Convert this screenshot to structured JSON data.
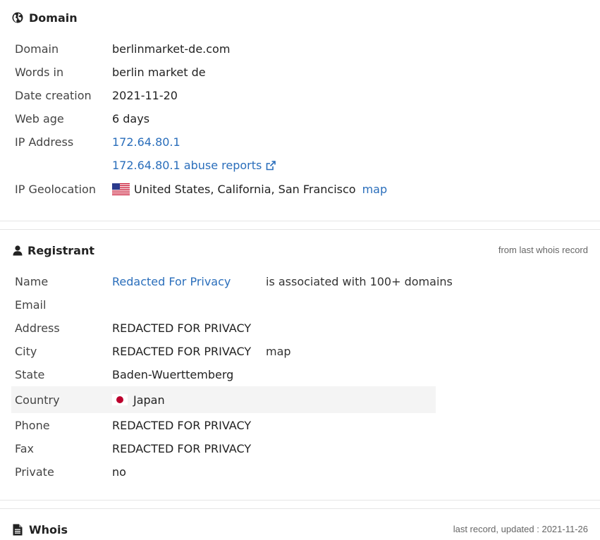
{
  "domain_section": {
    "title": "Domain",
    "rows": {
      "domain": {
        "label": "Domain",
        "value": "berlinmarket-de.com"
      },
      "words": {
        "label": "Words in",
        "value": "berlin market de"
      },
      "creation": {
        "label": "Date creation",
        "value": "2021-11-20"
      },
      "webage": {
        "label": "Web age",
        "value": "6 days"
      },
      "ip": {
        "label": "IP Address",
        "value": "172.64.80.1"
      },
      "abuse": {
        "value": "172.64.80.1 abuse reports"
      },
      "geo": {
        "label": "IP Geolocation",
        "value": "United States, California, San Francisco",
        "map": "map"
      }
    }
  },
  "registrant_section": {
    "title": "Registrant",
    "note": "from last whois record",
    "rows": {
      "name": {
        "label": "Name",
        "value": "Redacted For Privacy",
        "extra": "is associated with 100+ domains"
      },
      "email": {
        "label": "Email",
        "value": ""
      },
      "address": {
        "label": "Address",
        "value": "REDACTED FOR PRIVACY"
      },
      "city": {
        "label": "City",
        "value": "REDACTED FOR PRIVACY",
        "map": "map"
      },
      "state": {
        "label": "State",
        "value": "Baden-Wuerttemberg"
      },
      "country": {
        "label": "Country",
        "value": "Japan"
      },
      "phone": {
        "label": "Phone",
        "value": "REDACTED FOR PRIVACY"
      },
      "fax": {
        "label": "Fax",
        "value": "REDACTED FOR PRIVACY"
      },
      "private": {
        "label": "Private",
        "value": "no"
      }
    }
  },
  "whois_section": {
    "title": "Whois",
    "note": "last record, updated : 2021-11-26"
  },
  "colors": {
    "link": "#2a6ebb",
    "shaded_row": "#f4f4f4",
    "divider": "#e6e6e6"
  },
  "icons": {
    "domain": "globe-icon",
    "registrant": "user-icon",
    "whois": "document-icon",
    "abuse": "external-link-icon"
  }
}
